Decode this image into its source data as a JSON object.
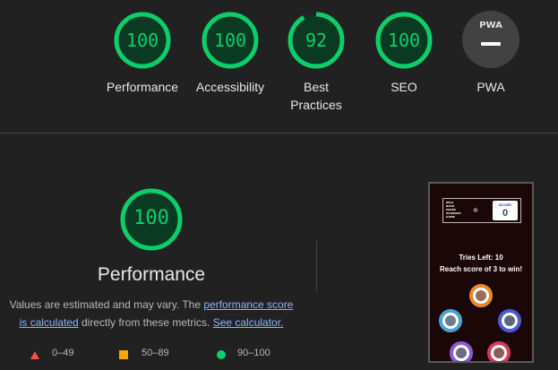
{
  "categories": [
    {
      "name": "Performance",
      "score": "100"
    },
    {
      "name": "Accessibility",
      "score": "100"
    },
    {
      "name": "Best",
      "name2": "Practices",
      "score": "92"
    },
    {
      "name": "SEO",
      "score": "100"
    },
    {
      "name": "PWA",
      "score": "",
      "badge": "PWA"
    }
  ],
  "colors": {
    "pass": "#0cce6b",
    "average": "#ffa400",
    "fail": "#ff4e42",
    "pwa_bg": "#424242"
  },
  "main": {
    "score": "100",
    "title": "Performance",
    "desc_part1": "Values are estimated and may vary. The ",
    "desc_link1": "performance score is calculated",
    "desc_part2": " directly from these metrics. ",
    "desc_link2": "See calculator."
  },
  "legend": [
    {
      "range": "0–49",
      "icon": "triangle-icon"
    },
    {
      "range": "50–89",
      "icon": "square-icon"
    },
    {
      "range": "90–100",
      "icon": "circle-icon"
    }
  ],
  "screenshot": {
    "logo_lines": [
      "REAL",
      "ROCK",
      "PAPER",
      "SCISSORS",
      "GAME"
    ],
    "score_label": "SCORE",
    "score_value": "0",
    "tries_line": "Tries Left: 10",
    "goal_line": "Reach score of 3 to win!"
  }
}
